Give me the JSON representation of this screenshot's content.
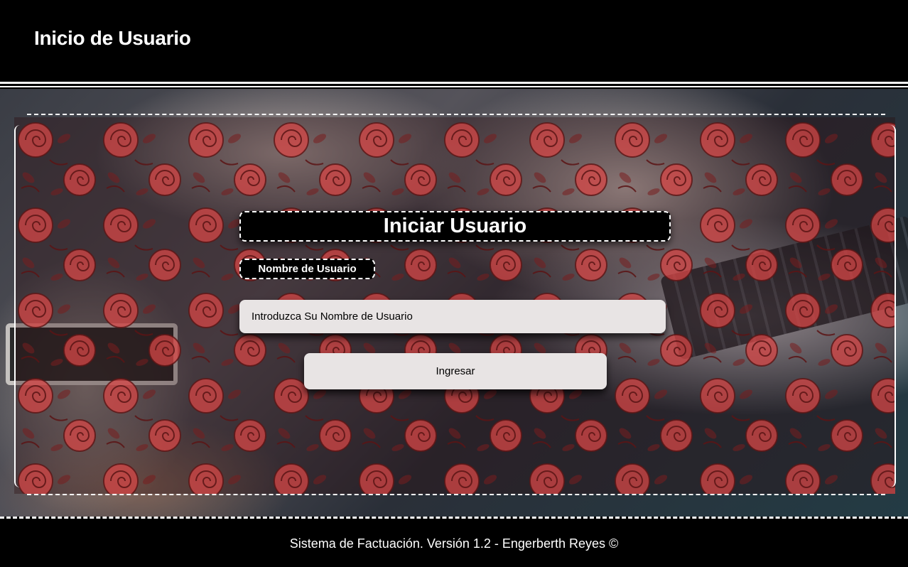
{
  "header": {
    "title": "Inicio de Usuario"
  },
  "login": {
    "heading": "Iniciar Usuario",
    "username_label": "Nombre de Usuario",
    "username_placeholder": "Introduzca Su Nombre de Usuario",
    "username_value": "",
    "submit_label": "Ingresar"
  },
  "footer": {
    "text": "Sistema de Factuación. Versión 1.2 - Engerberth Reyes ©"
  },
  "colors": {
    "header_background": "#000000",
    "rose_red": "#d64545",
    "input_background": "#e8e4e4",
    "border": "#ffffff"
  },
  "icons": [
    "rose-pattern"
  ]
}
